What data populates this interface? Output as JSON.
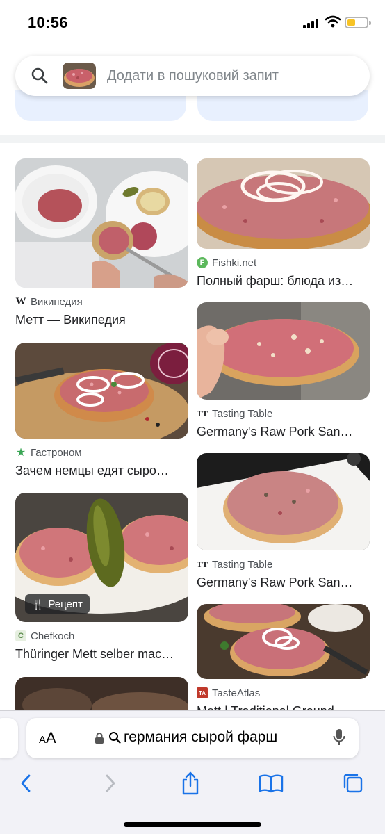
{
  "status_bar": {
    "time": "10:56"
  },
  "search": {
    "placeholder": "Додати в пошуковий запит"
  },
  "results": [
    {
      "source": "Википедия",
      "favicon": "W",
      "title": "Метт — Википедия"
    },
    {
      "source": "Fishki.net",
      "favicon": "F",
      "title": "Полный фарш: блюда из…"
    },
    {
      "source": "Гастроном",
      "favicon": "★",
      "title": "Зачем немцы едят сыро…"
    },
    {
      "source": "Tasting Table",
      "favicon": "TT",
      "title": "Germany's Raw Pork San…"
    },
    {
      "source": "Chefkoch",
      "favicon": "C",
      "title": "Thüringer Mett selber mac…",
      "badge": "Рецепт"
    },
    {
      "source": "Tasting Table",
      "favicon": "TT",
      "title": "Germany's Raw Pork San…"
    },
    {
      "source": "TasteAtlas",
      "favicon": "TA",
      "title": "Mett | Traditional Ground…"
    }
  ],
  "browser": {
    "aa_label": "AA",
    "query": "германия сырой фарш"
  },
  "colors": {
    "accent_blue": "#1a73e8",
    "chip_bg": "#e8f0fe",
    "fishki_green": "#5cb85c",
    "gastronom_green": "#3aa655",
    "tasteatlas_red": "#c0392b"
  }
}
